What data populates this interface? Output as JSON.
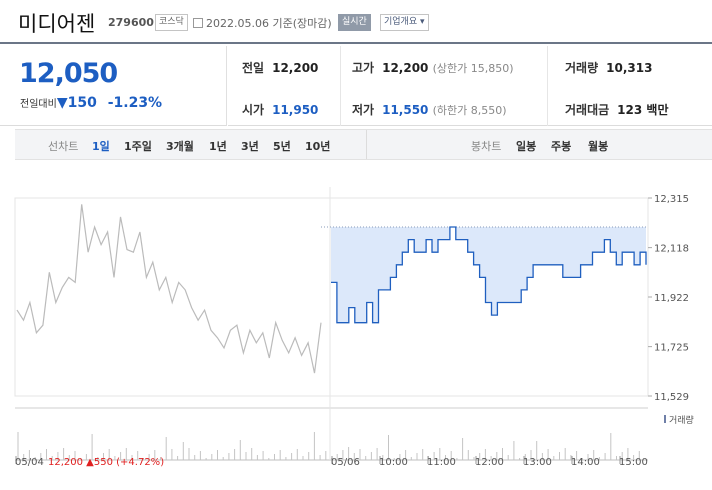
{
  "header": {
    "name": "미디어젠",
    "code": "279600",
    "market": "코스닥",
    "date": "2022.05.06",
    "status": "기준(장마감)",
    "realtime_label": "실시간",
    "company_info_label": "기업개요"
  },
  "quote": {
    "price": "12,050",
    "change_label": "전일대비",
    "change_arrow": "▼",
    "change_value": "150",
    "change_pct": "-1.23%",
    "prev_close_label": "전일",
    "prev_close": "12,200",
    "open_label": "시가",
    "open": "11,950",
    "high_label": "고가",
    "high": "12,200",
    "upper_limit": "(상한가 15,850)",
    "low_label": "저가",
    "low": "11,550",
    "lower_limit": "(하한가 8,550)",
    "volume_label": "거래량",
    "volume": "10,313",
    "amount_label": "거래대금",
    "amount": "123 백만"
  },
  "period_bar": {
    "line_label": "선차트",
    "line_options": [
      "1일",
      "1주일",
      "3개월",
      "1년",
      "3년",
      "5년",
      "10년"
    ],
    "candle_label": "봉차트",
    "candle_options": [
      "일봉",
      "주봉",
      "월봉"
    ],
    "selected": "1일"
  },
  "colors": {
    "accent_blue": "#1d5ec2",
    "up_red": "#e02020",
    "price_line": "#1f5fbf",
    "prev_line": "#bbbbbb",
    "fill": "#dce8fa"
  },
  "chart_data": {
    "type": "line",
    "y_ticks": [
      "12,315",
      "12,118",
      "11,922",
      "11,725",
      "11,529"
    ],
    "ylim": [
      11529,
      12315
    ],
    "x_labels": [
      "05/04",
      "05/06",
      "10:00",
      "11:00",
      "12:00",
      "13:00",
      "14:00",
      "15:00"
    ],
    "volume_label": "거래량",
    "prev_day_summary": {
      "date": "05/04",
      "close": "12,200",
      "arrow": "▲",
      "change": "550",
      "pct": "(+4.72%)"
    },
    "series": [
      {
        "values": [
          11870,
          11830,
          11900,
          11780,
          11810,
          12020,
          11900,
          11960,
          12000,
          11980,
          12290,
          12100,
          12200,
          12130,
          12180,
          12000,
          12240,
          12110,
          12100,
          12180,
          12000,
          12060,
          11950,
          12000,
          11900,
          11980,
          11950,
          11880,
          11830,
          11870,
          11790,
          11760,
          11720,
          11790,
          11810,
          11700,
          11790,
          11740,
          11780,
          11680,
          11820,
          11750,
          11700,
          11760,
          11690,
          11740,
          11620,
          11820
        ]
      },
      {
        "values": [
          11980,
          11820,
          11820,
          11880,
          11820,
          11820,
          11900,
          11820,
          11950,
          11950,
          12000,
          12050,
          12100,
          12150,
          12100,
          12100,
          12150,
          12100,
          12150,
          12150,
          12200,
          12150,
          12150,
          12100,
          12050,
          12000,
          11900,
          11850,
          11900,
          11900,
          11900,
          11900,
          11950,
          12000,
          12050,
          12050,
          12050,
          12050,
          12050,
          12000,
          12000,
          12000,
          12050,
          12050,
          12100,
          12100,
          12150,
          12100,
          12050,
          12100,
          12100,
          12050,
          12100,
          12050
        ]
      }
    ]
  }
}
